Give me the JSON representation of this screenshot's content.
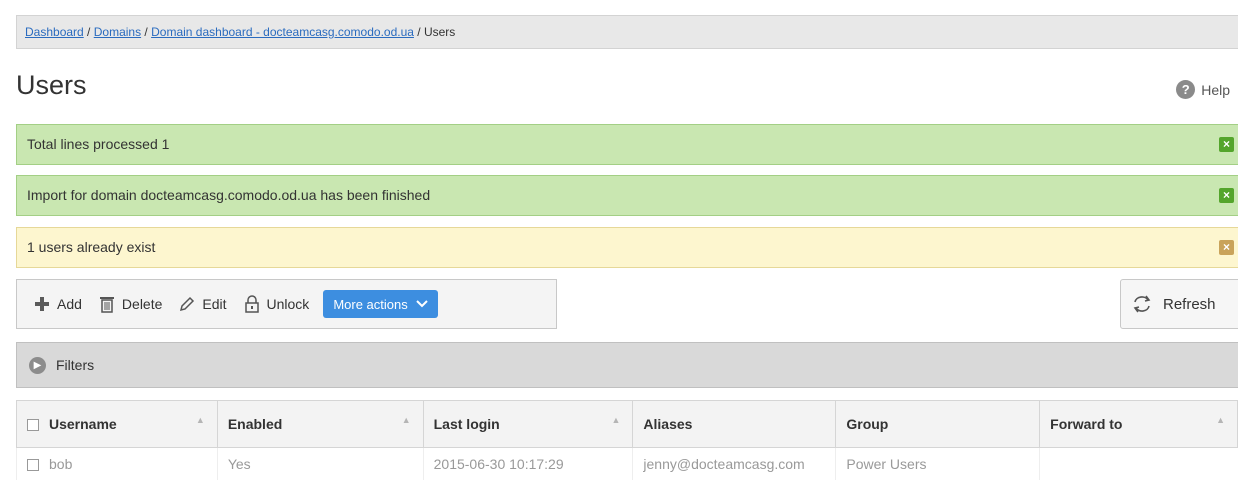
{
  "breadcrumb": {
    "items": [
      "Dashboard",
      "Domains",
      "Domain dashboard - docteamcasg.comodo.od.ua"
    ],
    "current": "Users",
    "separator": " / "
  },
  "page": {
    "title": "Users",
    "help_label": "Help",
    "help_icon": "?"
  },
  "alerts": [
    {
      "text": "Total lines processed 1",
      "type": "success"
    },
    {
      "text": "Import for domain docteamcasg.comodo.od.ua has been finished",
      "type": "success"
    },
    {
      "text": "1 users already exist",
      "type": "warning"
    }
  ],
  "toolbar": {
    "add": "Add",
    "delete": "Delete",
    "edit": "Edit",
    "unlock": "Unlock",
    "more_actions": "More actions",
    "refresh": "Refresh"
  },
  "filters": {
    "label": "Filters"
  },
  "table": {
    "headers": [
      "Username",
      "Enabled",
      "Last login",
      "Aliases",
      "Group",
      "Forward to"
    ],
    "rows": [
      {
        "username": "bob",
        "enabled": "Yes",
        "last_login": "2015-06-30 10:17:29",
        "aliases": "jenny@docteamcasg.com",
        "group": "Power Users",
        "forward_to": ""
      }
    ]
  },
  "colors": {
    "success": "#c9e7b1",
    "warning": "#fdf6cf",
    "accent": "#3d8ee0",
    "link": "#2a6bbf"
  }
}
